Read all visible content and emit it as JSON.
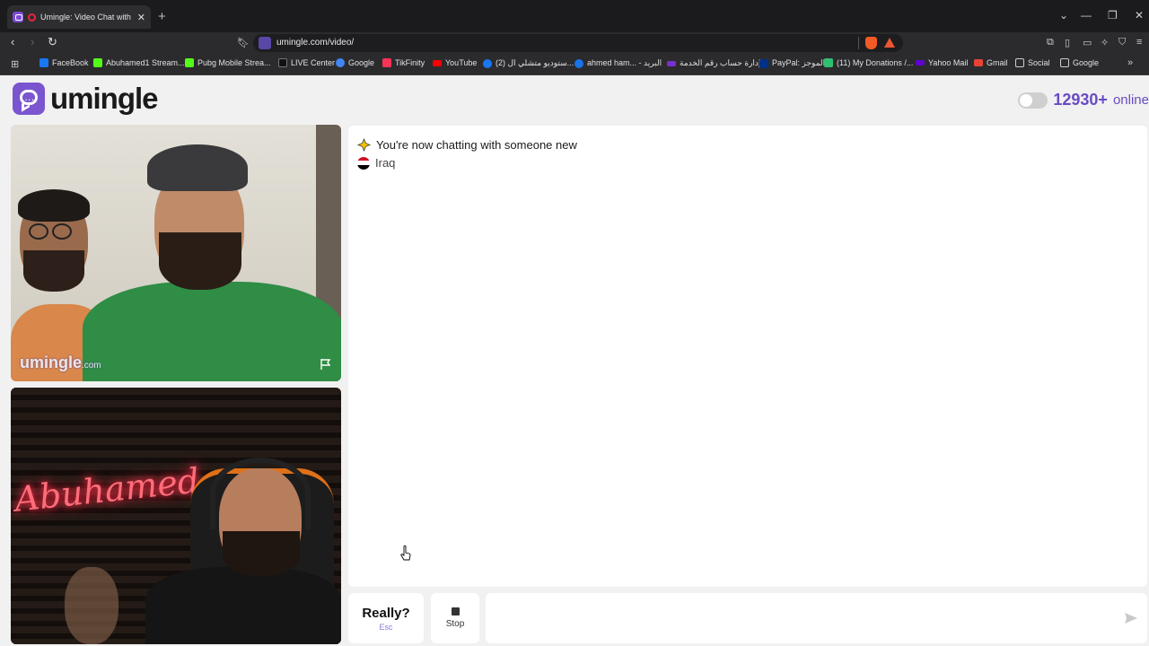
{
  "browser": {
    "tab_title": "Umingle: Video Chat with Strangers",
    "new_tab": "+",
    "url": "umingle.com/video/",
    "window_controls": [
      "⌄",
      "—",
      "❐",
      "✕"
    ]
  },
  "bookmarks": [
    {
      "label": "FaceBook",
      "color": "#1877f2"
    },
    {
      "label": "Abuhamed1 Stream...",
      "color": "#53fc18"
    },
    {
      "label": "Pubg Mobile Strea...",
      "color": "#53fc18"
    },
    {
      "label": "LIVE Center",
      "color": "#111111"
    },
    {
      "label": "Google",
      "color": "#4285f4"
    },
    {
      "label": "TikFinity",
      "color": "#ff3355"
    },
    {
      "label": "YouTube",
      "color": "#ff0000"
    },
    {
      "label": "(2) ستوديو متشلي ال...",
      "color": "#1877f2"
    },
    {
      "label": "ahmed ham... - البريد",
      "color": "#1a73e8"
    },
    {
      "label": "إدارة حساب رقم الخدمة",
      "color": "#7a2fd0"
    },
    {
      "label": "PayPal: الموجز",
      "color": "#003087"
    },
    {
      "label": "(11) My Donations /...",
      "color": "#2fbf71"
    },
    {
      "label": "Yahoo Mail",
      "color": "#6001d2"
    },
    {
      "label": "Gmail",
      "color": "#ea4335"
    },
    {
      "label": "Social",
      "color": "#cccccc"
    },
    {
      "label": "Google",
      "color": "#cccccc"
    }
  ],
  "site": {
    "logo_text": "umingle",
    "online_count": "12930+",
    "online_word": "online",
    "brand_color": "#6a4bc4"
  },
  "video": {
    "watermark_main": "umingle",
    "watermark_suffix": ".com",
    "neon_text": "Abuhamed"
  },
  "chat": {
    "status_message": "You're now chatting with someone new",
    "country": "Iraq"
  },
  "controls": {
    "really_label": "Really?",
    "really_hint": "Esc",
    "stop_label": "Stop",
    "message_placeholder": ""
  }
}
